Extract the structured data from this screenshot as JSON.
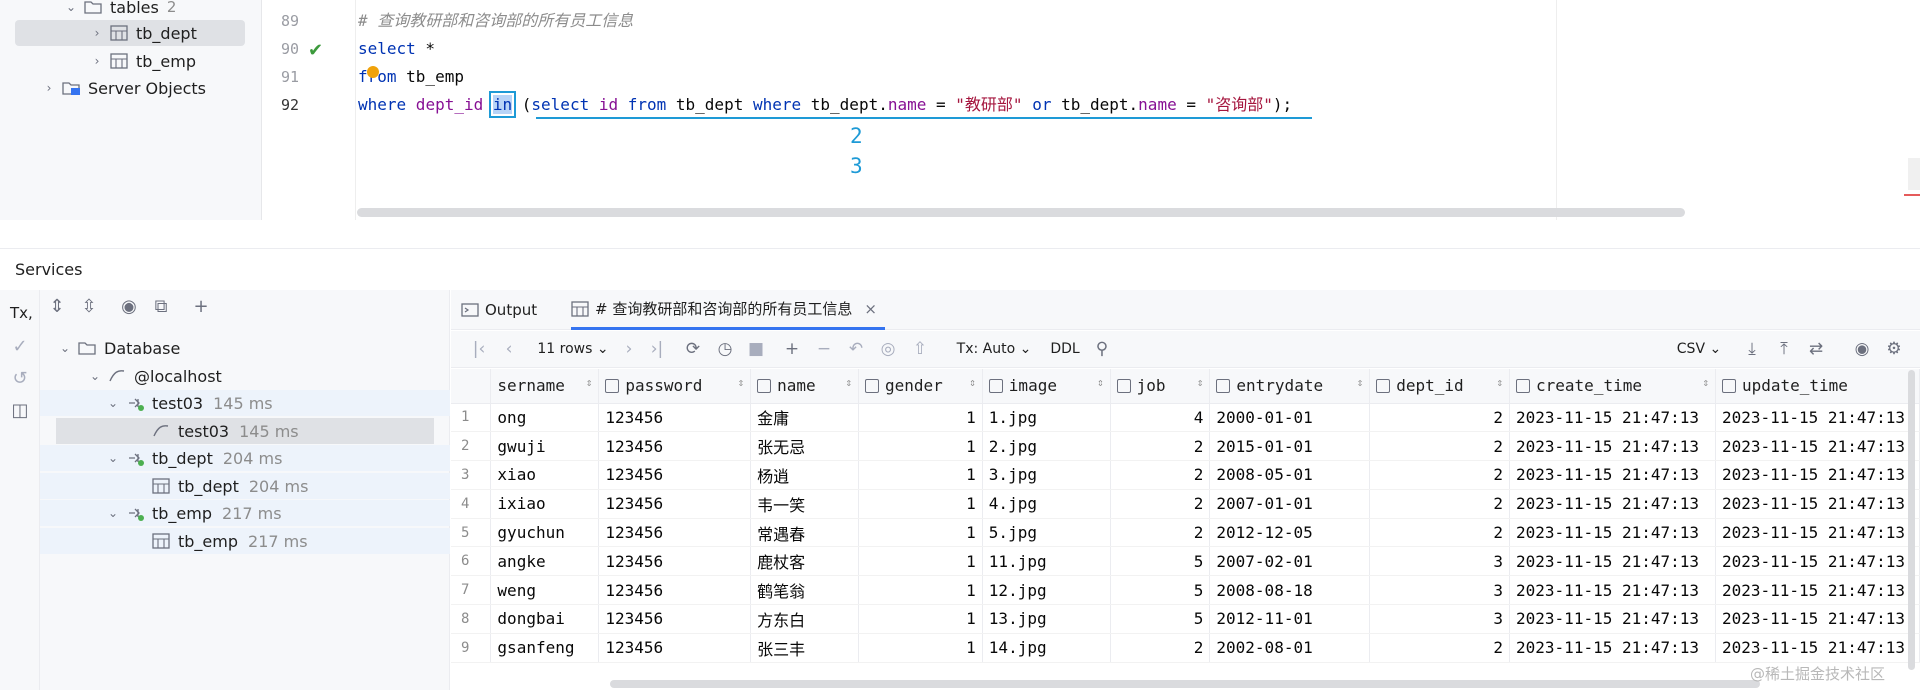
{
  "top_tree": {
    "tables_label": "tables",
    "tables_count": "2",
    "items": [
      "tb_dept",
      "tb_emp"
    ],
    "server_objects": "Server Objects"
  },
  "editor": {
    "line_numbers": [
      "89",
      "90",
      "91",
      "92"
    ],
    "comment": "# 查询教研部和咨询部的所有员工信息",
    "line90": {
      "kw": "select",
      "rest": " *"
    },
    "line91": {
      "kw1": "fr",
      "kw2": "om",
      "rest": " tb_emp"
    },
    "line92": {
      "where": "where",
      "field": " dept_id ",
      "in": "in",
      "p1": " (",
      "select": "select",
      "id": " id ",
      "from": "from",
      "tbl": " tb_dept ",
      "where2": "where",
      "t1": " tb_dept.",
      "name1": "name",
      "eq1": " = ",
      "s1": "\"教研部\"",
      "or": " or",
      "t2": " tb_dept.",
      "name2": "name",
      "eq2": " = ",
      "s2": "\"咨询部\"",
      "end": ");"
    },
    "hints": [
      "2",
      "3"
    ]
  },
  "services": {
    "title": "Services",
    "tx_label": "Tx,",
    "tree": [
      {
        "label": "Database",
        "ms": ""
      },
      {
        "label": "@localhost",
        "ms": ""
      },
      {
        "label": "test03",
        "ms": "145 ms"
      },
      {
        "label": "test03",
        "ms": "145 ms"
      },
      {
        "label": "tb_dept",
        "ms": "204 ms"
      },
      {
        "label": "tb_dept",
        "ms": "204 ms"
      },
      {
        "label": "tb_emp",
        "ms": "217 ms"
      },
      {
        "label": "tb_emp",
        "ms": "217 ms"
      }
    ]
  },
  "results": {
    "tabs": [
      "Output",
      "# 查询教研部和咨询部的所有员工信息"
    ],
    "rows_label": "11 rows",
    "tx_mode": "Tx: Auto",
    "ddl": "DDL",
    "export": "CSV",
    "columns": [
      "sername",
      "password",
      "name",
      "gender",
      "image",
      "job",
      "entrydate",
      "dept_id",
      "create_time",
      "update_time"
    ],
    "rows": [
      [
        "1",
        "ong",
        "123456",
        "金庸",
        "1",
        "1.jpg",
        "4",
        "2000-01-01",
        "2",
        "2023-11-15 21:47:13",
        "2023-11-15 21:47:13"
      ],
      [
        "2",
        "gwuji",
        "123456",
        "张无忌",
        "1",
        "2.jpg",
        "2",
        "2015-01-01",
        "2",
        "2023-11-15 21:47:13",
        "2023-11-15 21:47:13"
      ],
      [
        "3",
        "xiao",
        "123456",
        "杨逍",
        "1",
        "3.jpg",
        "2",
        "2008-05-01",
        "2",
        "2023-11-15 21:47:13",
        "2023-11-15 21:47:13"
      ],
      [
        "4",
        "ixiao",
        "123456",
        "韦一笑",
        "1",
        "4.jpg",
        "2",
        "2007-01-01",
        "2",
        "2023-11-15 21:47:13",
        "2023-11-15 21:47:13"
      ],
      [
        "5",
        "gyuchun",
        "123456",
        "常遇春",
        "1",
        "5.jpg",
        "2",
        "2012-12-05",
        "2",
        "2023-11-15 21:47:13",
        "2023-11-15 21:47:13"
      ],
      [
        "6",
        "angke",
        "123456",
        "鹿杖客",
        "1",
        "11.jpg",
        "5",
        "2007-02-01",
        "3",
        "2023-11-15 21:47:13",
        "2023-11-15 21:47:13"
      ],
      [
        "7",
        "weng",
        "123456",
        "鹤笔翁",
        "1",
        "12.jpg",
        "5",
        "2008-08-18",
        "3",
        "2023-11-15 21:47:13",
        "2023-11-15 21:47:13"
      ],
      [
        "8",
        "dongbai",
        "123456",
        "方东白",
        "1",
        "13.jpg",
        "5",
        "2012-11-01",
        "3",
        "2023-11-15 21:47:13",
        "2023-11-15 21:47:13"
      ],
      [
        "9",
        "gsanfeng",
        "123456",
        "张三丰",
        "1",
        "14.jpg",
        "2",
        "2002-08-01",
        "2",
        "2023-11-15 21:47:13",
        "2023-11-15 21:47:13"
      ]
    ]
  },
  "watermark": "@稀土掘金技术社区"
}
